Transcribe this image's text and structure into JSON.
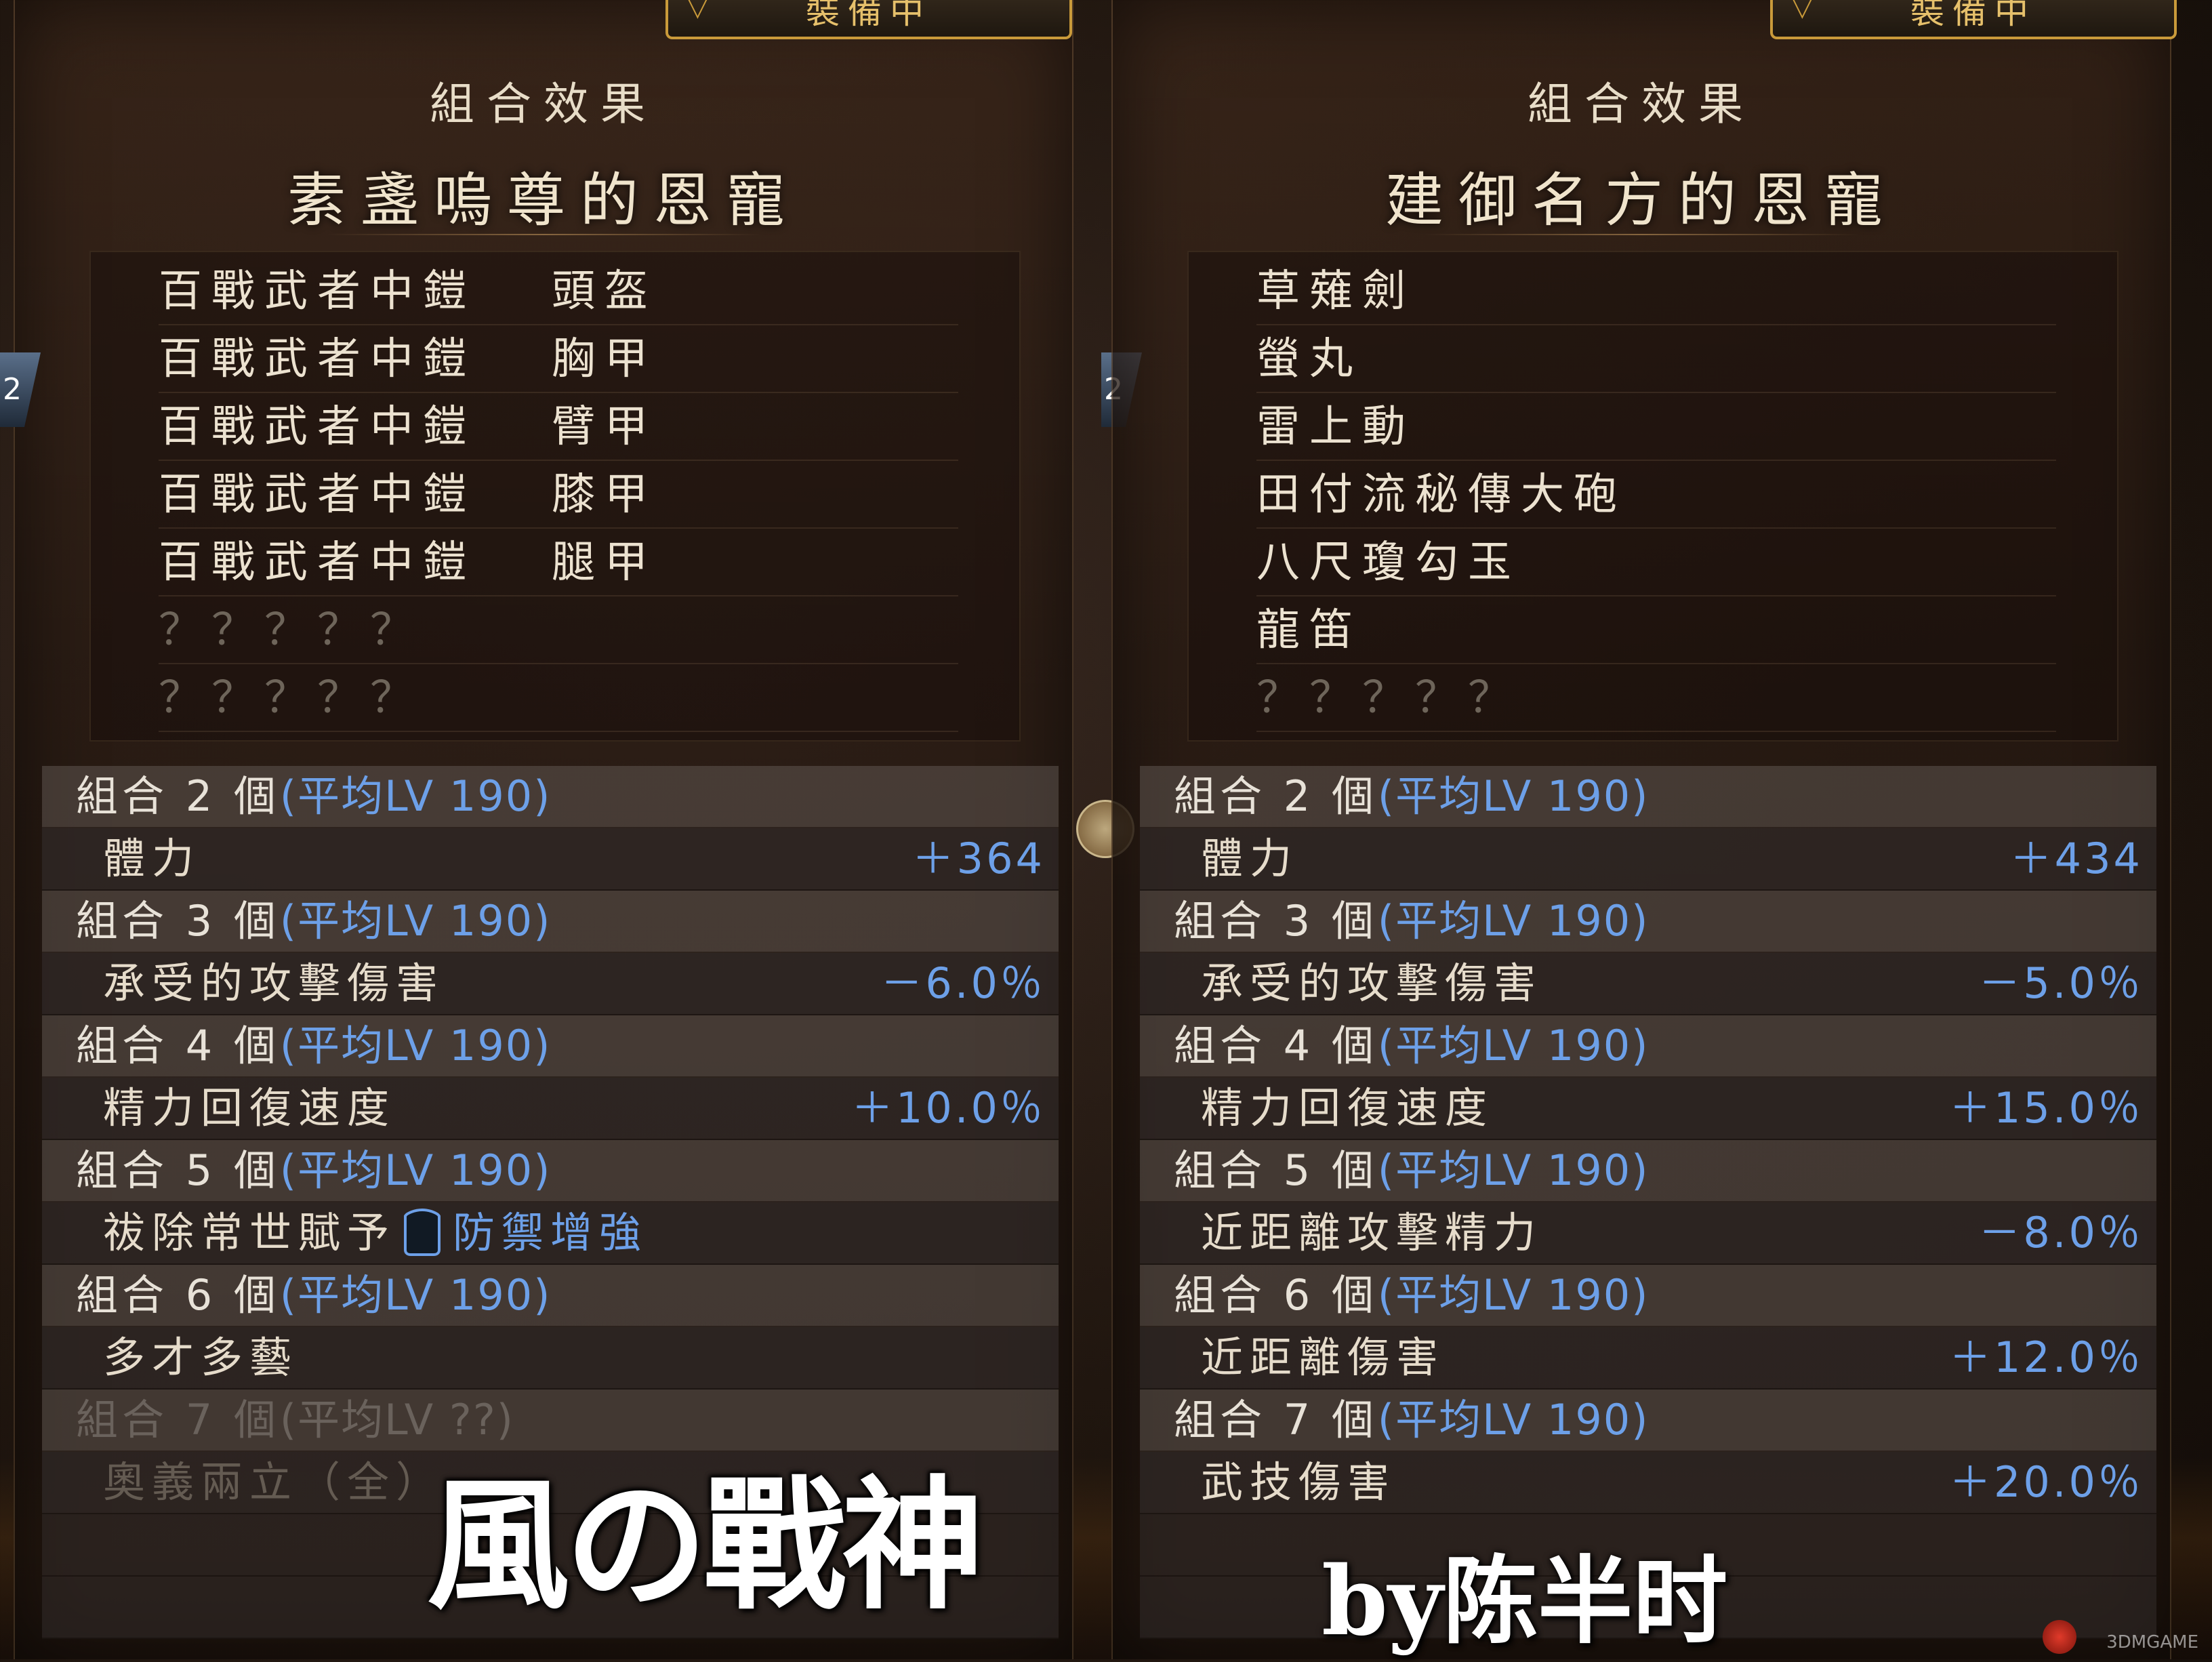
{
  "equip_tab_label": "裝備中",
  "left": {
    "combo_title": "組合效果",
    "set_name": "素盞嗚尊的恩寵",
    "pieces": [
      {
        "name": "百戰武者中鎧",
        "part": "頭盔"
      },
      {
        "name": "百戰武者中鎧",
        "part": "胸甲"
      },
      {
        "name": "百戰武者中鎧",
        "part": "臂甲"
      },
      {
        "name": "百戰武者中鎧",
        "part": "膝甲"
      },
      {
        "name": "百戰武者中鎧",
        "part": "腿甲"
      },
      {
        "name": "？？？？？",
        "part": ""
      },
      {
        "name": "？？？？？",
        "part": ""
      }
    ],
    "combos": [
      {
        "label": "組合 2 個",
        "lv": "(平均LV 190)",
        "effect": "體力",
        "value": "＋364"
      },
      {
        "label": "組合 3 個",
        "lv": "(平均LV 190)",
        "effect": "承受的攻擊傷害",
        "value": "－6.0％"
      },
      {
        "label": "組合 4 個",
        "lv": "(平均LV 190)",
        "effect": "精力回復速度",
        "value": "＋10.0％"
      },
      {
        "label": "組合 5 個",
        "lv": "(平均LV 190)",
        "effect": "祓除常世賦予",
        "effect_extra": "防禦增強",
        "value": ""
      },
      {
        "label": "組合 6 個",
        "lv": "(平均LV 190)",
        "effect": "多才多藝",
        "value": ""
      },
      {
        "label": "組合 7 個",
        "lv": "(平均LV ??)",
        "effect": "奧義兩立（全）",
        "value": ""
      }
    ]
  },
  "right": {
    "combo_title": "組合效果",
    "set_name": "建御名方的恩寵",
    "pieces": [
      {
        "name": "草薙劍"
      },
      {
        "name": "螢丸"
      },
      {
        "name": "雷上動"
      },
      {
        "name": "田付流秘傳大砲"
      },
      {
        "name": "八尺瓊勾玉"
      },
      {
        "name": "龍笛"
      },
      {
        "name": "？？？？？"
      }
    ],
    "combos": [
      {
        "label": "組合 2 個",
        "lv": "(平均LV 190)",
        "effect": "體力",
        "value": "＋434"
      },
      {
        "label": "組合 3 個",
        "lv": "(平均LV 190)",
        "effect": "承受的攻擊傷害",
        "value": "－5.0％"
      },
      {
        "label": "組合 4 個",
        "lv": "(平均LV 190)",
        "effect": "精力回復速度",
        "value": "＋15.0％"
      },
      {
        "label": "組合 5 個",
        "lv": "(平均LV 190)",
        "effect": "近距離攻擊精力",
        "value": "－8.0％"
      },
      {
        "label": "組合 6 個",
        "lv": "(平均LV 190)",
        "effect": "近距離傷害",
        "value": "＋12.0％"
      },
      {
        "label": "組合 7 個",
        "lv": "(平均LV 190)",
        "effect": "武技傷害",
        "value": "＋20.0％"
      }
    ]
  },
  "overlay": {
    "calligraphy": "風の戰神",
    "author": "by陈半时"
  },
  "side_tab_number": "2",
  "watermark": "3DMGAME",
  "colors": {
    "accent_blue": "#6da0e8",
    "gold": "#c99a3a"
  }
}
